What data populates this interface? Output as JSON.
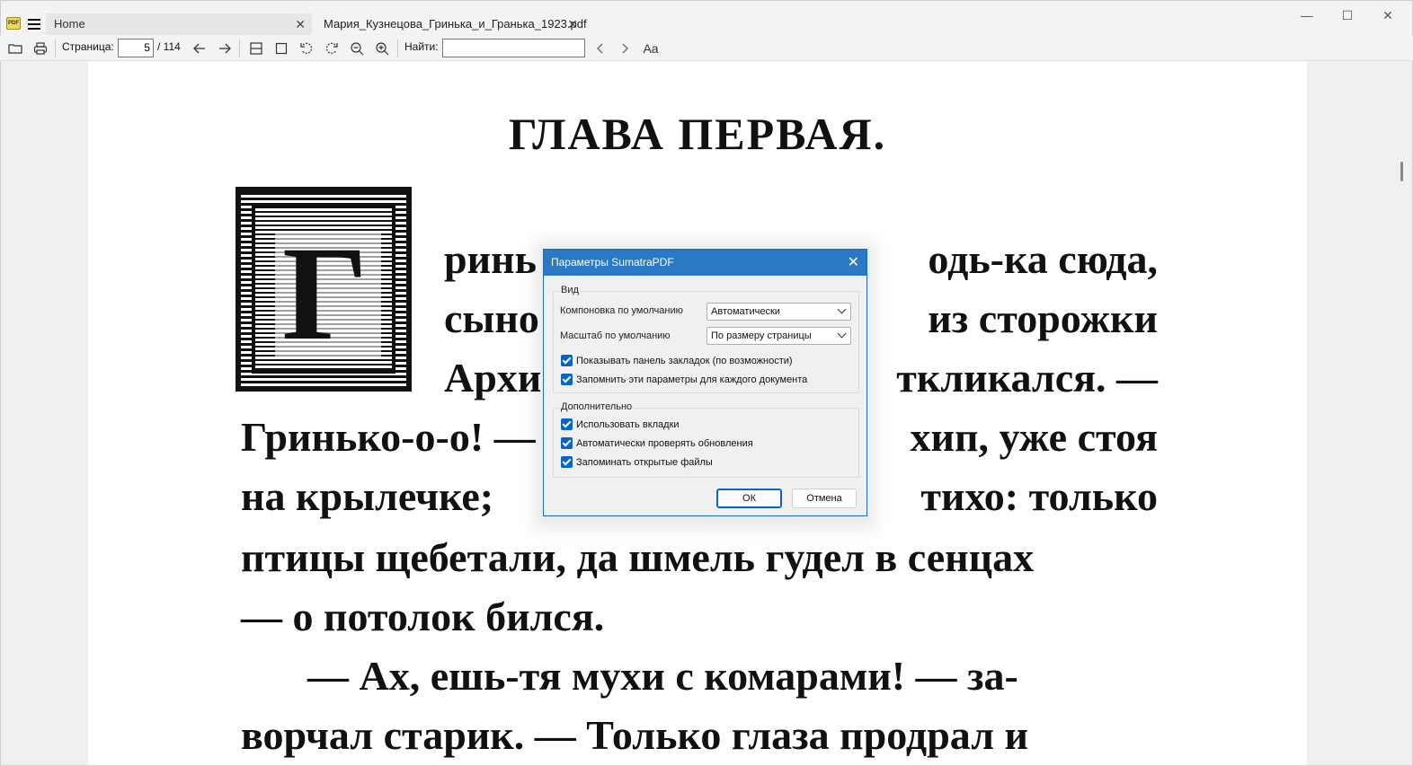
{
  "app": {
    "icon_text": "PDF"
  },
  "tabs": [
    {
      "label": "Home"
    },
    {
      "label": "Мария_Кузнецова_Гринька_и_Гранька_1923.pdf"
    }
  ],
  "window": {
    "minimize": "—",
    "maximize": "☐",
    "close": "✕"
  },
  "toolbar": {
    "page_label": "Страница:",
    "page_value": "5",
    "page_total": "/ 114",
    "find_label": "Найти:",
    "find_value": "",
    "font_icon_text": "Aa"
  },
  "document": {
    "heading": "ГЛАВА ПЕРВАЯ.",
    "lines": [
      "ринька! — Гринька! — подь-ка  сюда,",
      "сынок! — кричал из  сторожки",
      "Архип,  но  никто  не  откликался.  —",
      "Гринько-о-о! — заорал Архип, уже стоя",
      "на крылечке;  но  вокруг  было  тихо: только",
      "птицы щебетали, да шмель гудел в сенцах",
      "— о потолок бился.",
      "— Ах, ешь-тя мухи с комарами! — за-",
      "ворчал старик. — Только глаза продрал и"
    ],
    "visible_fragments": {
      "l1a": "ринь",
      "l1b": "одь-ка  сюда,",
      "l2a": "сыно",
      "l2b": "из  сторожки",
      "l3a": "Архи",
      "l3b": "ткликался.  —",
      "l4a": "Гринько-о-о! —",
      "l4b": "хип, уже стоя",
      "l5a": "на  крылечке;",
      "l5b": "тихо: только",
      "l6": "птицы  щебетали,  да  шмель  гудел  в  сенцах",
      "l7": "—  о  потолок  бился.",
      "l8": "—  Ах,  ешь-тя  мухи  с  комарами!  —  за-",
      "l9": "ворчал  старик.  —  Только  глаза  продрал  и"
    },
    "initial_letter": "Г"
  },
  "dialog": {
    "title": "Параметры SumatraPDF",
    "view_group": "Вид",
    "layout_label": "Компоновка по умолчанию",
    "layout_value": "Автоматически",
    "zoom_label": "Масштаб по умолчанию",
    "zoom_value": "По размеру страницы",
    "show_bookmarks": "Показывать панель закладок (по возможности)",
    "remember_params": "Запомнить эти параметры для каждого документа",
    "advanced_group": "Дополнительно",
    "use_tabs": "Использовать вкладки",
    "auto_updates": "Автоматически проверять обновления",
    "remember_files": "Запоминать открытые файлы",
    "ok": "ОК",
    "cancel": "Отмена"
  }
}
